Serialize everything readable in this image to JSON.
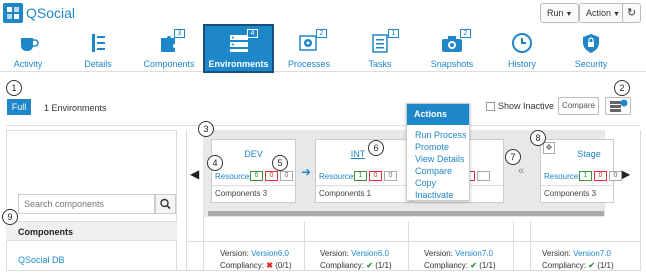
{
  "header": {
    "app_title": "QSocial",
    "run_label": "Run",
    "action_label": "Action",
    "refresh_icon": "refresh-icon"
  },
  "tabs": [
    {
      "label": "Activity",
      "icon": "cup-icon"
    },
    {
      "label": "Details",
      "icon": "list-icon"
    },
    {
      "label": "Components",
      "icon": "puzzle-icon",
      "badge": "3"
    },
    {
      "label": "Environments",
      "icon": "server-icon",
      "badge": "4",
      "active": true
    },
    {
      "label": "Processes",
      "icon": "gears-icon",
      "badge": "2"
    },
    {
      "label": "Tasks",
      "icon": "clipboard-icon",
      "badge": "1"
    },
    {
      "label": "Snapshots",
      "icon": "camera-icon",
      "badge": "2"
    },
    {
      "label": "History",
      "icon": "clock-icon"
    },
    {
      "label": "Security",
      "icon": "lock-icon"
    }
  ],
  "callouts": [
    "1",
    "2",
    "3",
    "4",
    "5",
    "6",
    "7",
    "8",
    "9"
  ],
  "toolbar": {
    "full_label": "Full",
    "env_count": "1 Environments",
    "show_inactive_label": "Show Inactive",
    "compare_label": "Compare"
  },
  "environments": [
    {
      "name": "DEV",
      "resources_label": "Resources",
      "counts": [
        "6",
        "0",
        "0"
      ],
      "components": "Components 3"
    },
    {
      "name": "INT",
      "resources_label": "Resources",
      "counts": [
        "1",
        "0",
        "0"
      ],
      "components": "Components 1"
    },
    {
      "name": "Stage",
      "resources_label": "Resources",
      "counts": [
        "1",
        "0",
        "0"
      ],
      "components": "Components 3"
    }
  ],
  "actions_menu": {
    "title": "Actions",
    "items": [
      "Run Process",
      "Promote",
      "View Details",
      "Compare",
      "Copy",
      "Inactivate"
    ]
  },
  "search": {
    "placeholder": "Search components"
  },
  "components": {
    "header": "Components",
    "rows": [
      {
        "name": "QSocial DB",
        "versions": [
          {
            "version_label": "Version:",
            "version": "Version6.0",
            "compliancy_label": "Compliancy:",
            "status": "fail",
            "count": "(0/1)"
          },
          {
            "version_label": "Version:",
            "version": "Version6.0",
            "compliancy_label": "Compliancy:",
            "status": "ok",
            "count": "(1/1)"
          },
          {
            "version_label": "Version:",
            "version": "Version7.0",
            "compliancy_label": "Compliancy:",
            "status": "ok",
            "count": "(1/1)"
          },
          {
            "version_label": "Version:",
            "version": "Version7.0",
            "compliancy_label": "Compliancy:",
            "status": "ok",
            "count": "(1/1)"
          }
        ]
      }
    ]
  },
  "colors": {
    "accent": "#1e87c9",
    "ok": "#3a9a3a",
    "fail": "#dd2222"
  }
}
